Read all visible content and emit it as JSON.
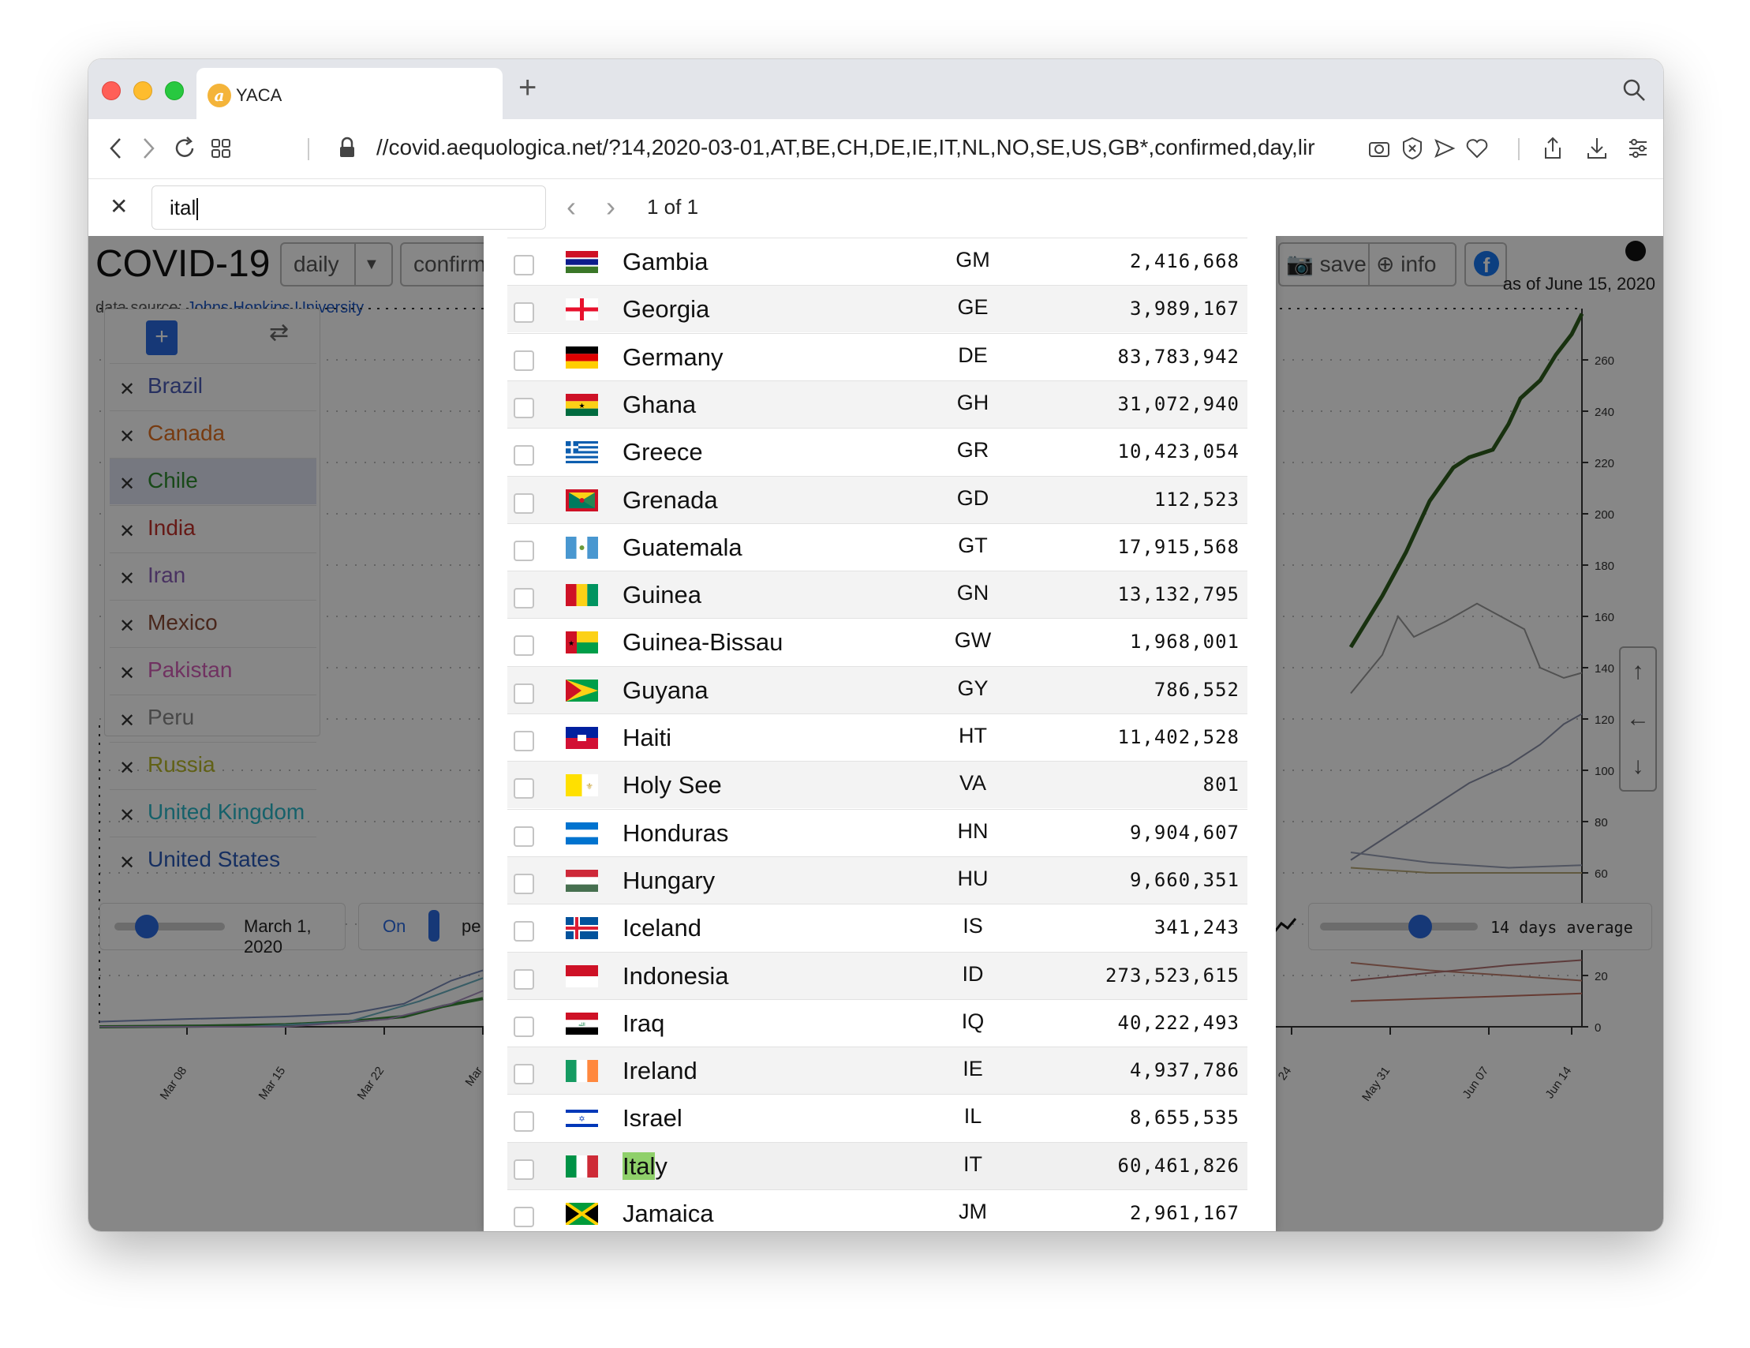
{
  "browser": {
    "tab_title": "YACA",
    "url": "//covid.aequologica.net/?14,2020-03-01,AT,BE,CH,DE,IE,IT,NL,NO,SE,US,GB*,confirmed,day,lir"
  },
  "find_bar": {
    "query": "ital",
    "count": "1 of 1"
  },
  "app": {
    "title": "COVID-19",
    "mode_button": "daily",
    "metric_button": "confirm",
    "save_label": "save",
    "info_label": "info",
    "data_source_prefix": "data source: ",
    "data_source_link": "Johns Hopkins University",
    "as_of": "as of June 15, 2020"
  },
  "selected_countries": [
    {
      "name": "Brazil",
      "color": "#4a5bb5"
    },
    {
      "name": "Canada",
      "color": "#e07020"
    },
    {
      "name": "Chile",
      "color": "#2e8a2e"
    },
    {
      "name": "India",
      "color": "#c0302a"
    },
    {
      "name": "Iran",
      "color": "#8a5fb8"
    },
    {
      "name": "Mexico",
      "color": "#8a4a36"
    },
    {
      "name": "Pakistan",
      "color": "#d45fb8"
    },
    {
      "name": "Peru",
      "color": "#888888"
    },
    {
      "name": "Russia",
      "color": "#b8b82a"
    },
    {
      "name": "United Kingdom",
      "color": "#2ab8c8"
    },
    {
      "name": "United States",
      "color": "#2a5ab8"
    }
  ],
  "chart_data": {
    "type": "line",
    "x_tick_labels": [
      "Mar 08",
      "Mar 15",
      "Mar 22",
      "Mar",
      "24",
      "May 31",
      "Jun 07",
      "Jun 14"
    ],
    "y_tick_labels": [
      "0",
      "20",
      "40",
      "60",
      "80",
      "100",
      "120",
      "140",
      "160",
      "180",
      "200",
      "220",
      "240",
      "260"
    ],
    "ylim": [
      0,
      280
    ]
  },
  "bottom_controls": {
    "date_label": "March 1, 2020",
    "toggle_label": "On",
    "pe_label": "pe",
    "average_label": "14 days average"
  },
  "dropdown_rows": [
    {
      "name": "Gambia",
      "code": "GM",
      "pop": "2,416,668",
      "flag": "gm"
    },
    {
      "name": "Georgia",
      "code": "GE",
      "pop": "3,989,167",
      "flag": "ge"
    },
    {
      "name": "Germany",
      "code": "DE",
      "pop": "83,783,942",
      "flag": "de"
    },
    {
      "name": "Ghana",
      "code": "GH",
      "pop": "31,072,940",
      "flag": "gh"
    },
    {
      "name": "Greece",
      "code": "GR",
      "pop": "10,423,054",
      "flag": "gr"
    },
    {
      "name": "Grenada",
      "code": "GD",
      "pop": "112,523",
      "flag": "gd"
    },
    {
      "name": "Guatemala",
      "code": "GT",
      "pop": "17,915,568",
      "flag": "gt"
    },
    {
      "name": "Guinea",
      "code": "GN",
      "pop": "13,132,795",
      "flag": "gn"
    },
    {
      "name": "Guinea-Bissau",
      "code": "GW",
      "pop": "1,968,001",
      "flag": "gw"
    },
    {
      "name": "Guyana",
      "code": "GY",
      "pop": "786,552",
      "flag": "gy"
    },
    {
      "name": "Haiti",
      "code": "HT",
      "pop": "11,402,528",
      "flag": "ht"
    },
    {
      "name": "Holy See",
      "code": "VA",
      "pop": "801",
      "flag": "va"
    },
    {
      "name": "Honduras",
      "code": "HN",
      "pop": "9,904,607",
      "flag": "hn"
    },
    {
      "name": "Hungary",
      "code": "HU",
      "pop": "9,660,351",
      "flag": "hu"
    },
    {
      "name": "Iceland",
      "code": "IS",
      "pop": "341,243",
      "flag": "is"
    },
    {
      "name": "Indonesia",
      "code": "ID",
      "pop": "273,523,615",
      "flag": "id"
    },
    {
      "name": "Iraq",
      "code": "IQ",
      "pop": "40,222,493",
      "flag": "iq"
    },
    {
      "name": "Ireland",
      "code": "IE",
      "pop": "4,937,786",
      "flag": "ie"
    },
    {
      "name": "Israel",
      "code": "IL",
      "pop": "8,655,535",
      "flag": "il"
    },
    {
      "name": "Italy",
      "code": "IT",
      "pop": "60,461,826",
      "flag": "it",
      "highlight": "Ital",
      "rest": "y"
    },
    {
      "name": "Jamaica",
      "code": "JM",
      "pop": "2,961,167",
      "flag": "jm"
    }
  ]
}
